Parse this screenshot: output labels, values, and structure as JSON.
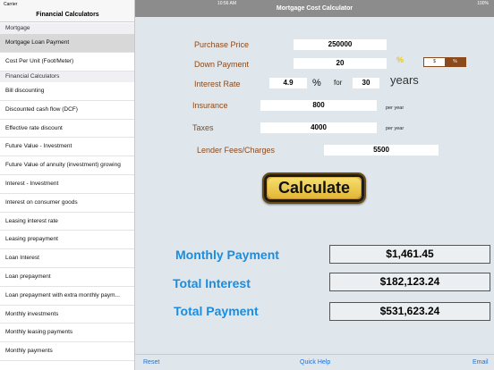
{
  "status": {
    "carrier": "Carrier",
    "wifi": "wifi",
    "time": "10:56 AM",
    "battery": "100%"
  },
  "sidebar": {
    "title": "Financial Calculators",
    "sections": [
      {
        "header": "Mortgage",
        "items": [
          "Mortgage Loan Payment",
          "Cost Per Unit (Foot/Meter)"
        ]
      },
      {
        "header": "Financial Calculators",
        "items": [
          "Bill discounting",
          "Discounted cash flow (DCF)",
          "Effective rate discount",
          "Future Value - Investment",
          "Future Value of annuity (investment) growing",
          "Interest - Investment",
          "Interest on consumer goods",
          "Leasing interest rate",
          "Leasing prepayment",
          "Loan Interest",
          "Loan prepayment",
          "Loan prepayment with extra monthly paym...",
          "Monthly investments",
          "Monthly leasing payments",
          "Monthly payments"
        ]
      }
    ],
    "selected": "Mortgage Loan Payment"
  },
  "nav": {
    "title": "Mortgage Cost Calculator"
  },
  "form": {
    "purchase_price": {
      "label": "Purchase Price",
      "value": "250000"
    },
    "down_payment": {
      "label": "Down Payment",
      "value": "20",
      "seg_dollar": "$",
      "seg_percent": "%"
    },
    "interest_rate": {
      "label": "Interest Rate",
      "value": "4.9",
      "percent": "%",
      "for": "for",
      "years_value": "30",
      "years_label": "years"
    },
    "insurance": {
      "label": "Insurance",
      "value": "800",
      "unit": "per year"
    },
    "taxes": {
      "label": "Taxes",
      "value": "4000",
      "unit": "per year"
    },
    "lender_fees": {
      "label": "Lender Fees/Charges",
      "value": "5500"
    }
  },
  "calculate_label": "Calculate",
  "results": {
    "monthly_payment": {
      "label": "Monthly Payment",
      "value": "$1,461.45"
    },
    "total_interest": {
      "label": "Total Interest",
      "value": "$182,123.24"
    },
    "total_payment": {
      "label": "Total Payment",
      "value": "$531,623.24"
    }
  },
  "toolbar": {
    "reset": "Reset",
    "quick_help": "Quick Help",
    "email": "Email"
  },
  "colors": {
    "label_brown": "#8a4a1c",
    "result_blue": "#1a8de0",
    "link_blue": "#1a6fd8",
    "button_gold": "#e2b636"
  }
}
